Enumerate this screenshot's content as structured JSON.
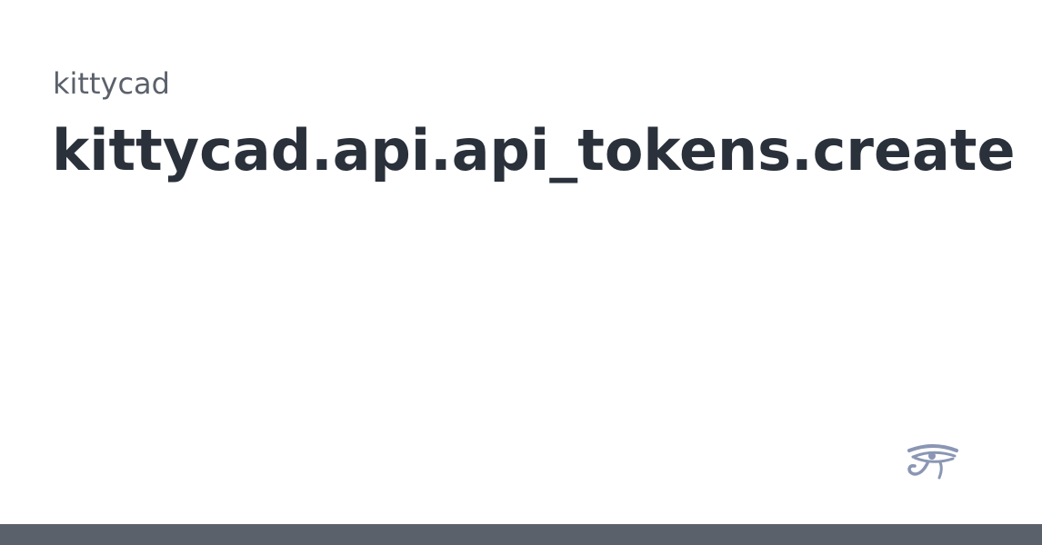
{
  "header": {
    "eyebrow": "kittycad",
    "title": "kittycad.api.api_tokens.create"
  },
  "logo": {
    "icon": "eye-of-horus-icon",
    "color": "#8a96b4"
  },
  "footer": {
    "bar_color": "#5b616b"
  }
}
